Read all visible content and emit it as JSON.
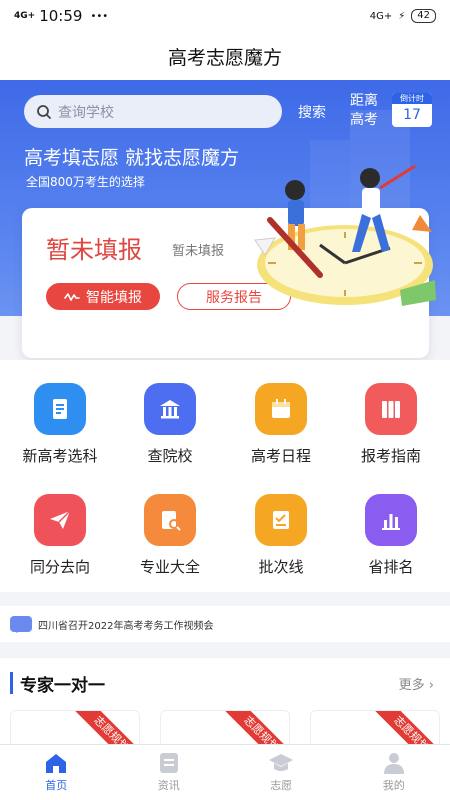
{
  "status_bar": {
    "network": "4G+",
    "time": "10:59",
    "network_right": "4G+",
    "battery": "42",
    "dots": "•••"
  },
  "header": {
    "title": "高考志愿魔方"
  },
  "search": {
    "placeholder": "查询学校",
    "button": "搜索"
  },
  "countdown": {
    "text": "距离高考",
    "badge_label": "倒计时",
    "days": "17"
  },
  "hero": {
    "title": "高考填志愿 就找志愿魔方",
    "subtitle": "全国800万考生的选择"
  },
  "fill_card": {
    "status_title": "暂未填报",
    "status_sub": "暂未填报",
    "smart_button": "智能填报",
    "report_button": "服务报告"
  },
  "features": [
    {
      "label": "新高考选科",
      "icon": "scroll-icon",
      "color": "#2f8ff0"
    },
    {
      "label": "查院校",
      "icon": "university-icon",
      "color": "#4d6ef0"
    },
    {
      "label": "高考日程",
      "icon": "calendar-icon",
      "color": "#f5a623"
    },
    {
      "label": "报考指南",
      "icon": "books-icon",
      "color": "#f25b5b"
    },
    {
      "label": "同分去向",
      "icon": "paper-plane-icon",
      "color": "#f0525a"
    },
    {
      "label": "专业大全",
      "icon": "document-search-icon",
      "color": "#f58a3c"
    },
    {
      "label": "批次线",
      "icon": "checklist-icon",
      "color": "#f5a623"
    },
    {
      "label": "省排名",
      "icon": "bar-chart-icon",
      "color": "#8a5cf0"
    }
  ],
  "notice": {
    "text": "四川省召开2022年高考考务工作视频会"
  },
  "experts": {
    "title": "专家一对一",
    "more": "更多",
    "ribbon": "志愿规划"
  },
  "tabbar": {
    "items": [
      {
        "label": "首页"
      },
      {
        "label": "资讯"
      },
      {
        "label": "志愿"
      },
      {
        "label": "我的"
      }
    ]
  }
}
